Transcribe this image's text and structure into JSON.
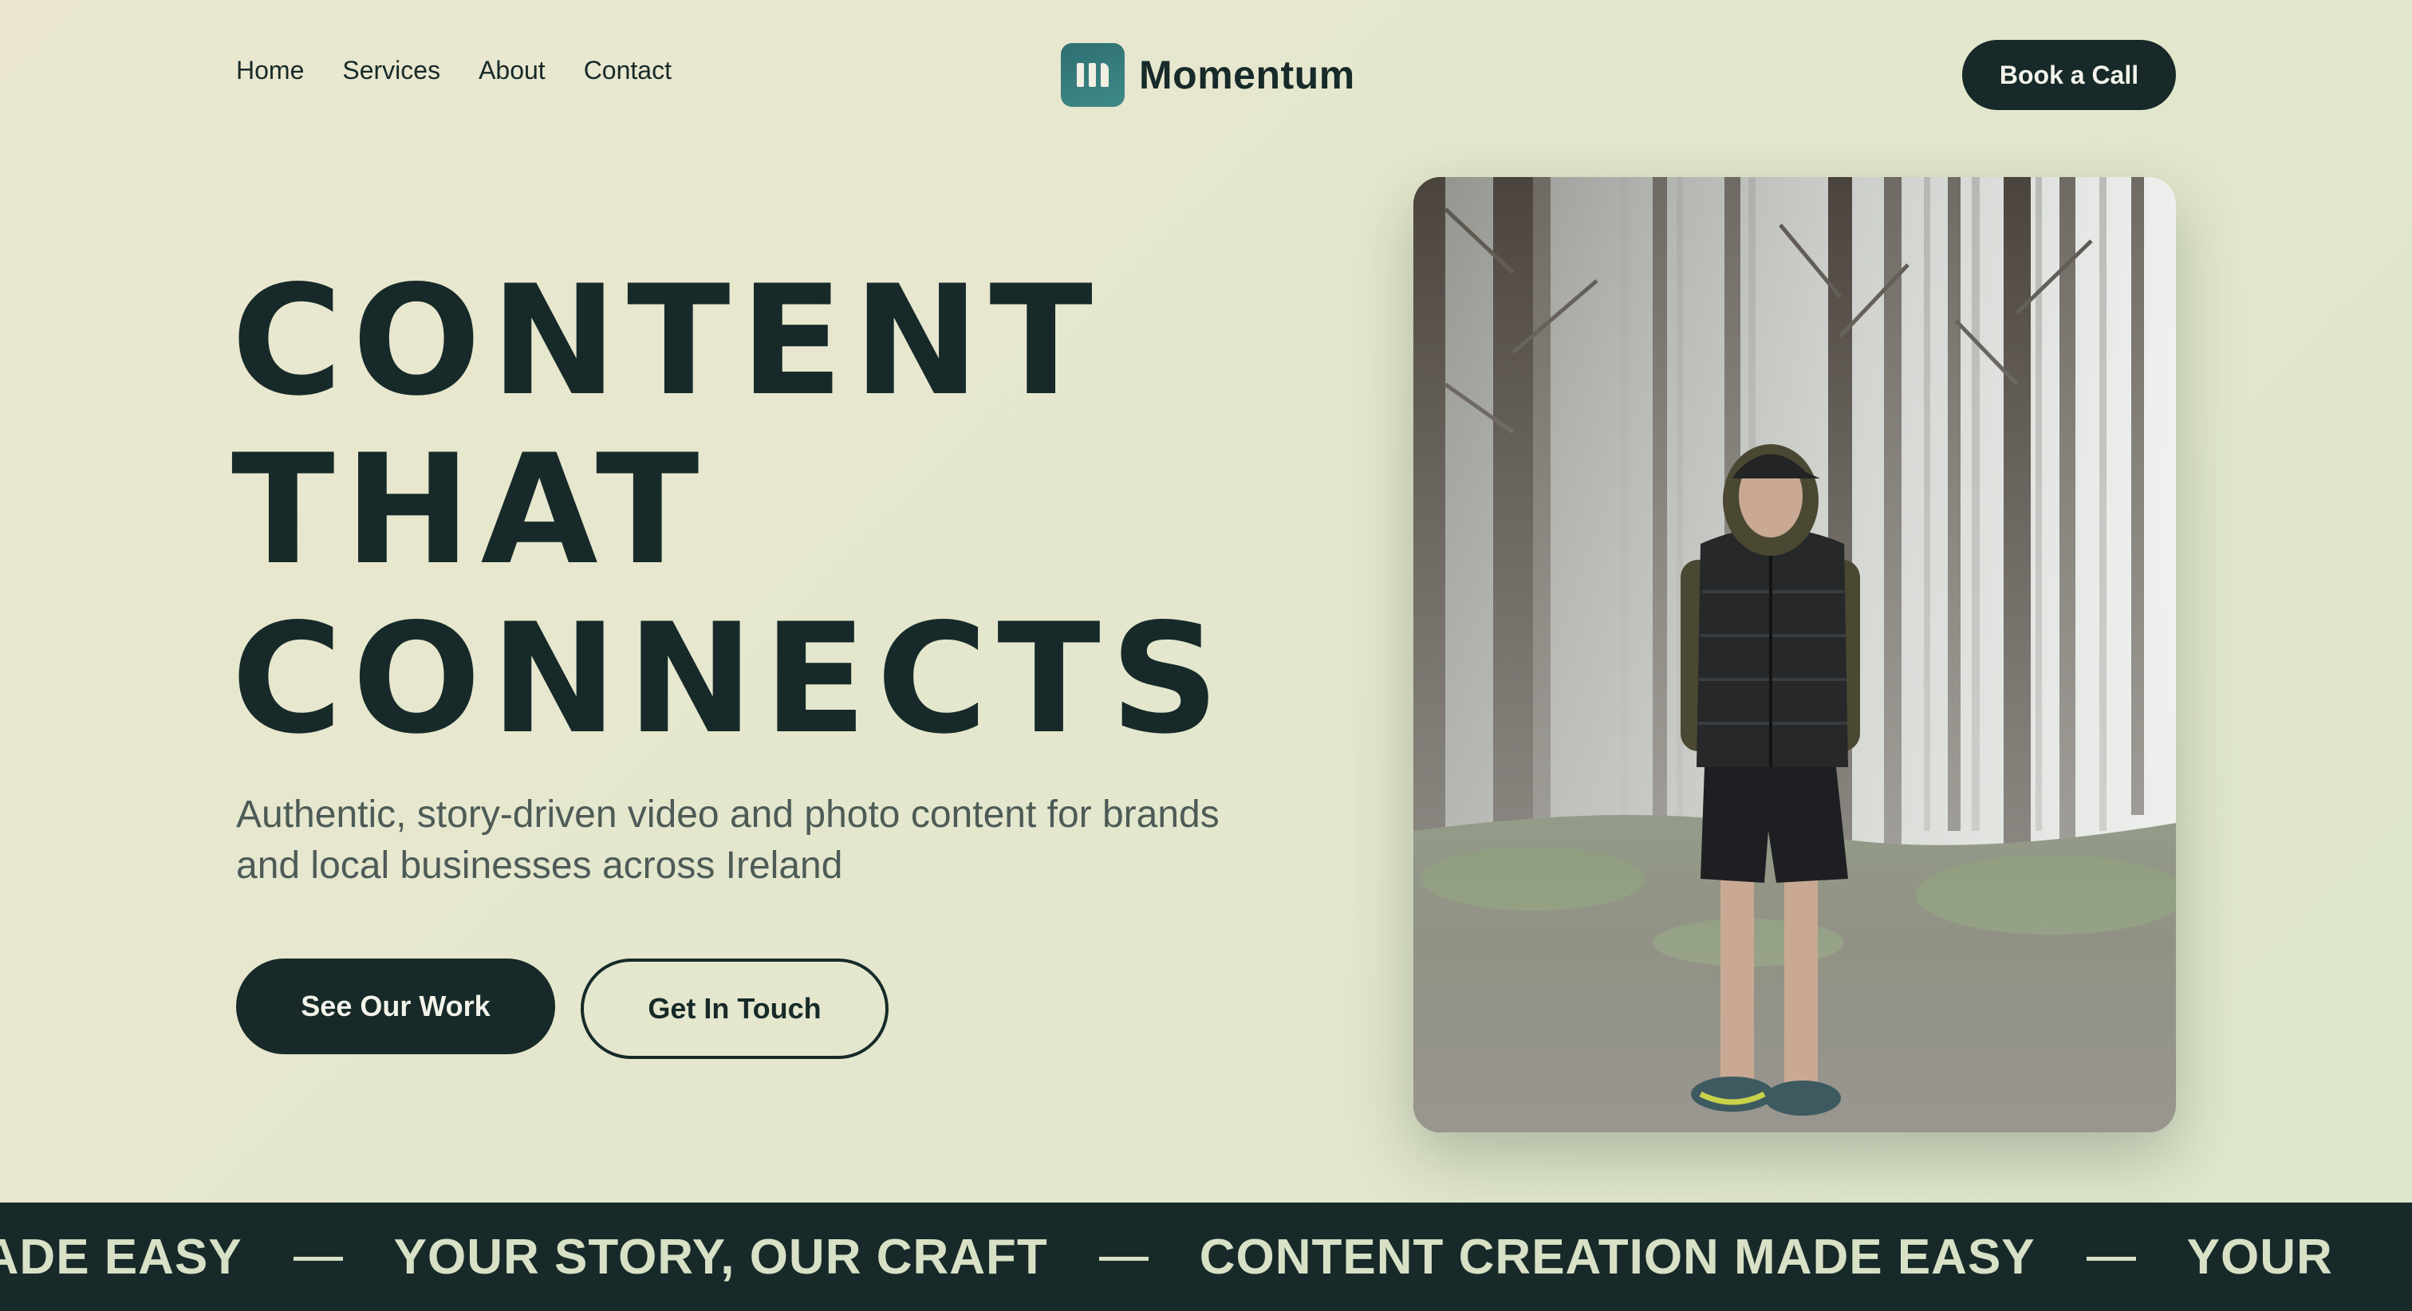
{
  "nav": {
    "links": [
      "Home",
      "Services",
      "About",
      "Contact"
    ],
    "brand_name": "Momentum",
    "brand_icon": "bars-logo-icon",
    "cta_label": "Book a Call"
  },
  "hero": {
    "headline_lines": [
      "CONTENT",
      "THAT",
      "CONNECTS"
    ],
    "subtitle": "Authentic, story-driven video and photo content for brands and local businesses across Ireland",
    "primary_button": "See Our Work",
    "secondary_button": "Get In Touch",
    "photo": "man-in-foggy-forest-photo"
  },
  "marquee": {
    "items": [
      "MADE EASY",
      "YOUR STORY, OUR CRAFT",
      "CONTENT CREATION MADE EASY",
      "YOUR"
    ]
  },
  "colors": {
    "dark": "#172a29",
    "background": "#e4e7cd",
    "accent_logo": "#2f6f73",
    "marquee_text": "#d8e0c6",
    "subtitle_text": "#4d5b57"
  }
}
